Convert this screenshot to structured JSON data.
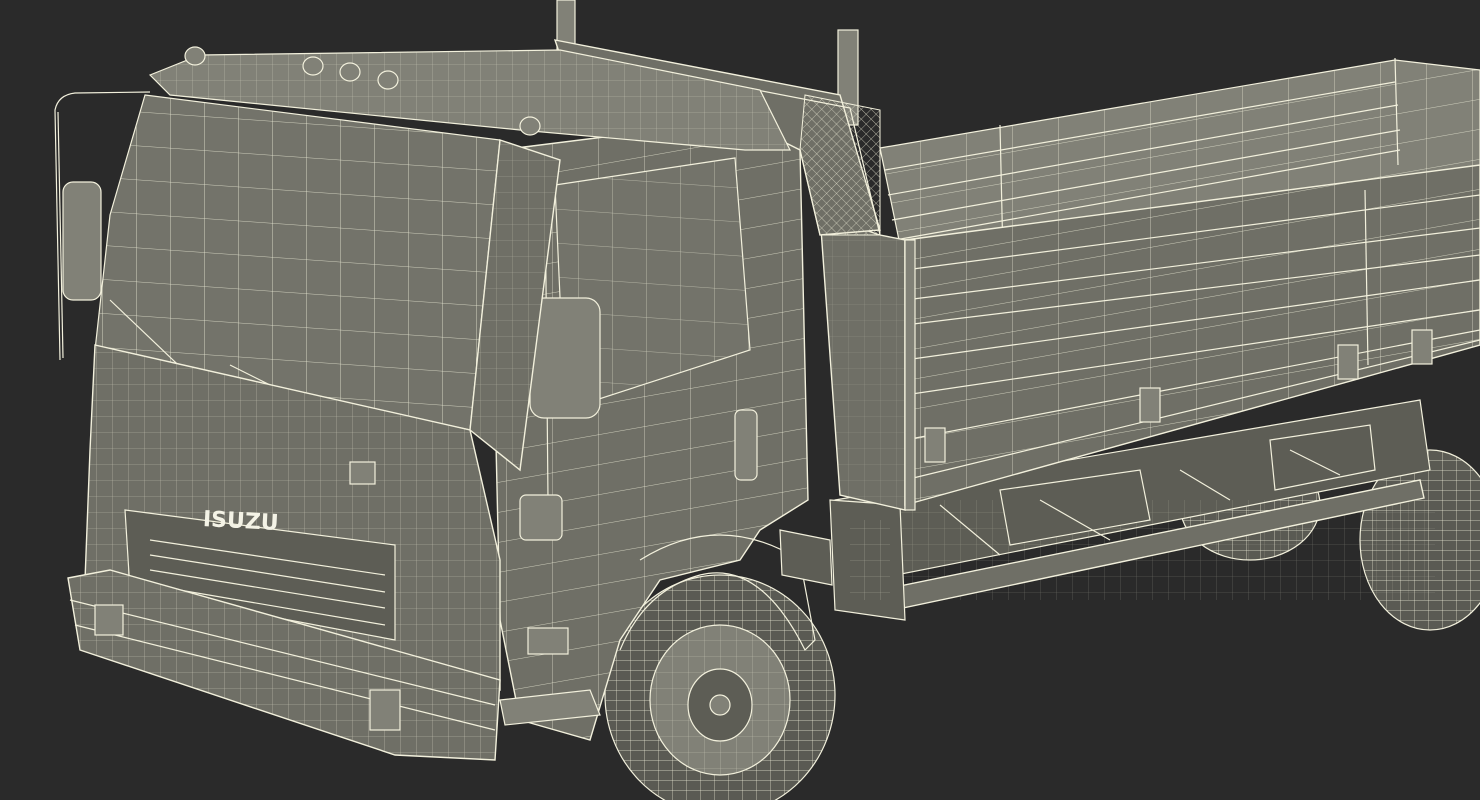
{
  "scene": {
    "background": "#2a2a2a",
    "model_color": "#6f6f66",
    "wire_color": "#f2f0dc"
  },
  "truck": {
    "grille_logo": "ISUZU"
  }
}
